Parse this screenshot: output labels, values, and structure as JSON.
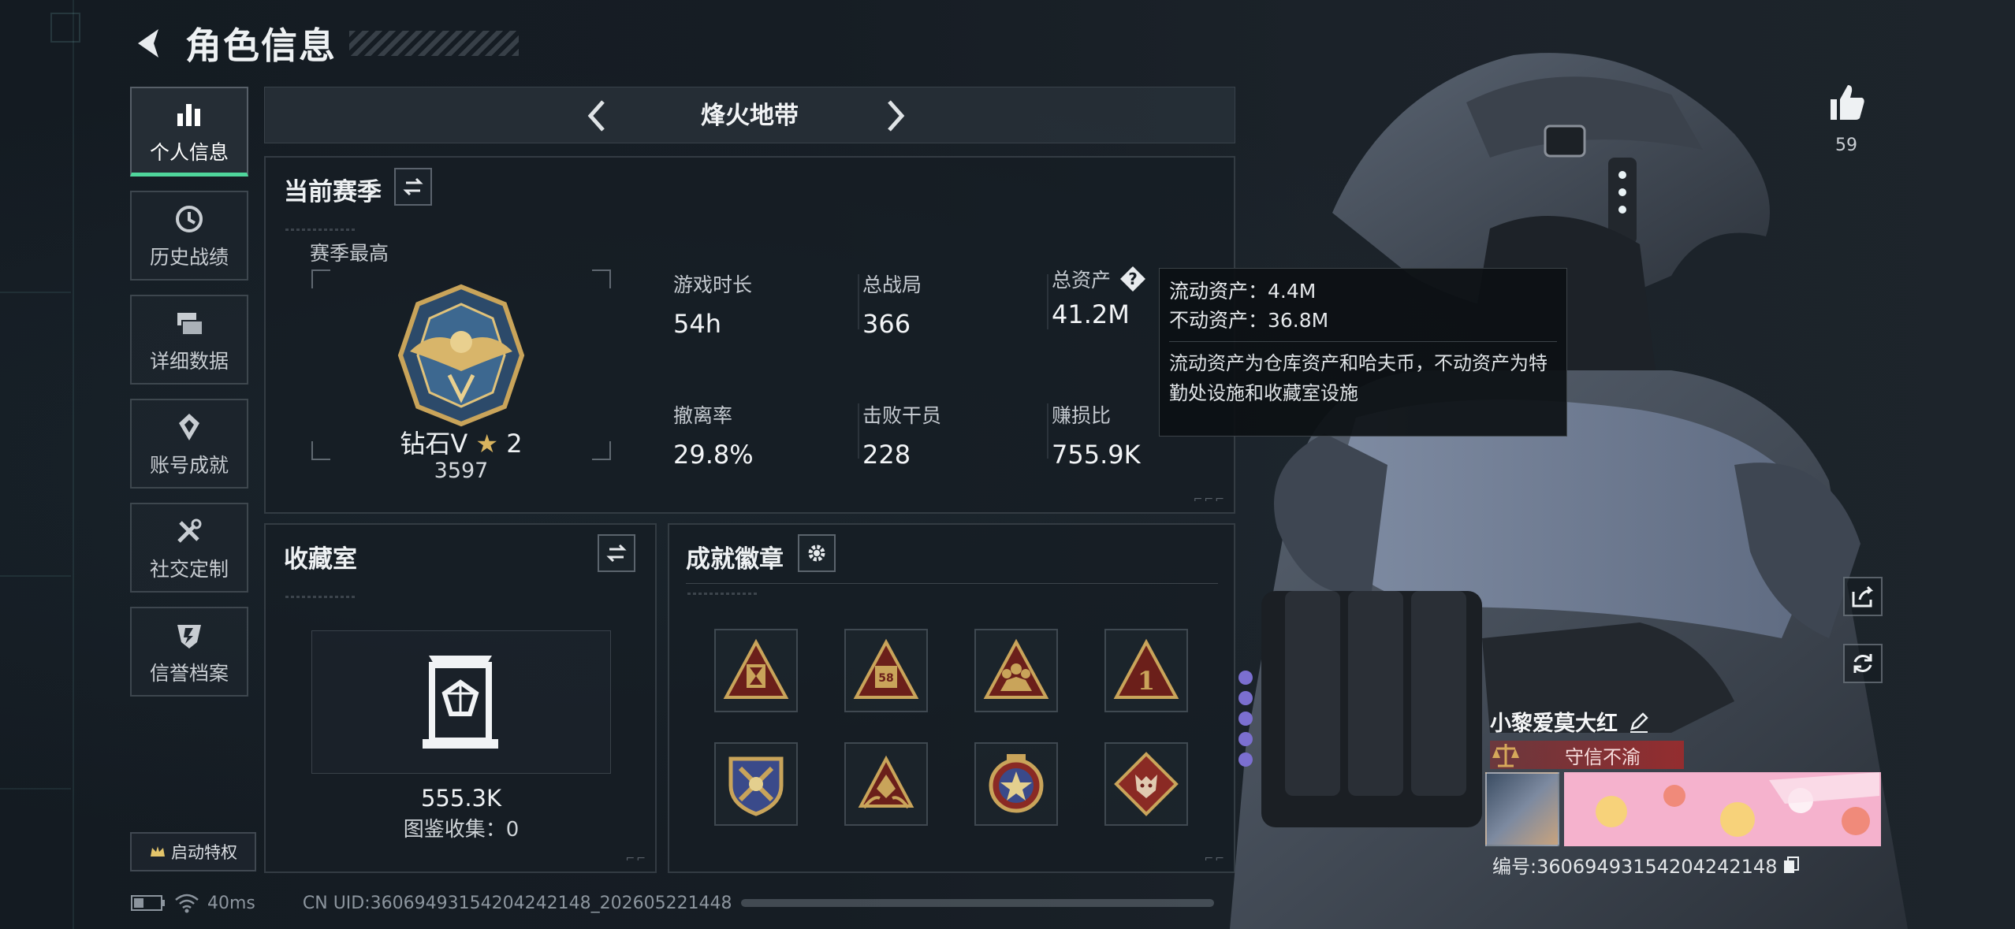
{
  "header": {
    "title": "角色信息"
  },
  "sidebar": {
    "items": [
      {
        "label": "个人信息",
        "icon": "bar-chart-icon",
        "active": true
      },
      {
        "label": "历史战绩",
        "icon": "clock-history-icon"
      },
      {
        "label": "详细数据",
        "icon": "stack-data-icon"
      },
      {
        "label": "账号成就",
        "icon": "achievement-icon"
      },
      {
        "label": "社交定制",
        "icon": "wrench-tools-icon"
      },
      {
        "label": "信誉档案",
        "icon": "credibility-shield-icon"
      }
    ],
    "privilege_label": "启动特权"
  },
  "mode": {
    "title": "烽火地带"
  },
  "season": {
    "title": "当前赛季",
    "subtitle": "赛季最高",
    "rank_name": "钻石V",
    "rank_stars": "2",
    "rank_score": "3597",
    "stats": [
      {
        "label": "游戏时长",
        "value": "54h"
      },
      {
        "label": "总战局",
        "value": "366"
      },
      {
        "label": "总资产",
        "value": "41.2M"
      },
      {
        "label": "撤离率",
        "value": "29.8%"
      },
      {
        "label": "击败干员",
        "value": "228"
      },
      {
        "label": "赚损比",
        "value": "755.9K"
      }
    ]
  },
  "tooltip": {
    "liquid": "流动资产：4.4M",
    "fixed": "不动资产：36.8M",
    "description": "流动资产为仓库资产和哈夫币，不动资产为特勤处设施和收藏室设施"
  },
  "collection": {
    "title": "收藏室",
    "value": "555.3K",
    "count_label": "图鉴收集：0"
  },
  "badges": {
    "title": "成就徽章",
    "icons": [
      "hourglass-badge-icon",
      "number-58-badge-icon",
      "team-badge-icon",
      "number-1-badge-icon",
      "shield-crest-badge-icon",
      "triangle-hands-badge-icon",
      "star-round-badge-icon",
      "wolf-diamond-badge-icon"
    ]
  },
  "profile": {
    "likes": "59",
    "name": "小黎爱莫大红",
    "title_badge": "守信不渝",
    "id_label": "编号:3606949315420424214​8"
  },
  "footer": {
    "ping": "40ms",
    "uid": "CN UID:3606949315420424214​8_2026052214​48"
  },
  "colors": {
    "accent": "#4fd69c",
    "badge_gold": "#c9a45a",
    "badge_red": "#8a2a24"
  }
}
